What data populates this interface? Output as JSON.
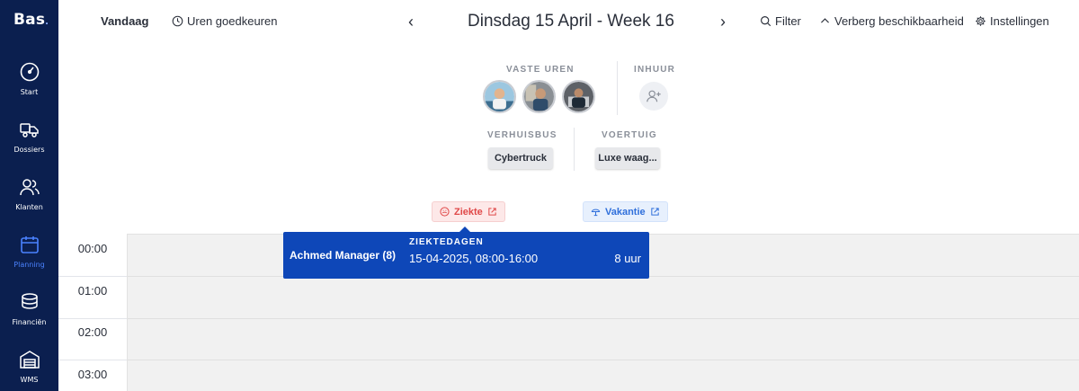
{
  "brand": {
    "logo_text": "Bas",
    "logo_dot": "."
  },
  "sidebar": {
    "items": [
      {
        "label": "Start",
        "icon": "gauge-icon",
        "active": false
      },
      {
        "label": "Dossiers",
        "icon": "truck-icon",
        "active": false
      },
      {
        "label": "Klanten",
        "icon": "customers-icon",
        "active": false
      },
      {
        "label": "Planning",
        "icon": "calendar-icon",
        "active": true
      },
      {
        "label": "Financiën",
        "icon": "coins-icon",
        "active": false
      },
      {
        "label": "WMS",
        "icon": "warehouse-icon",
        "active": false
      }
    ]
  },
  "toolbar": {
    "today_label": "Vandaag",
    "approve_hours_label": "Uren goedkeuren",
    "prev_symbol": "‹",
    "next_symbol": "›",
    "date_title": "Dinsdag 15 April - Week 16",
    "filter_label": "Filter",
    "hide_availability_label": "Verberg beschikbaarheid",
    "settings_label": "Instellingen"
  },
  "resources": {
    "fixed_hours_label": "VASTE UREN",
    "hire_label": "INHUUR",
    "moving_van_label": "VERHUISBUS",
    "vehicle_label": "VOERTUIG",
    "moving_van_items": [
      "Cybertruck"
    ],
    "vehicle_items": [
      "Luxe waag..."
    ]
  },
  "leave_tags": {
    "sick_label": "Ziekte",
    "vacation_label": "Vakantie"
  },
  "tooltip": {
    "employee": "Achmed Manager (8)",
    "type": "ZIEKTEDAGEN",
    "range": "15-04-2025, 08:00-16:00",
    "hours": "8 uur"
  },
  "timeline": {
    "hours": [
      "00:00",
      "01:00",
      "02:00",
      "03:00"
    ]
  },
  "colors": {
    "sidebar_bg": "#0b1f4f",
    "active_nav": "#4a82ff",
    "tooltip_bg": "#0e47b8",
    "sick": "#e04848",
    "vacation": "#2f6fdb"
  }
}
